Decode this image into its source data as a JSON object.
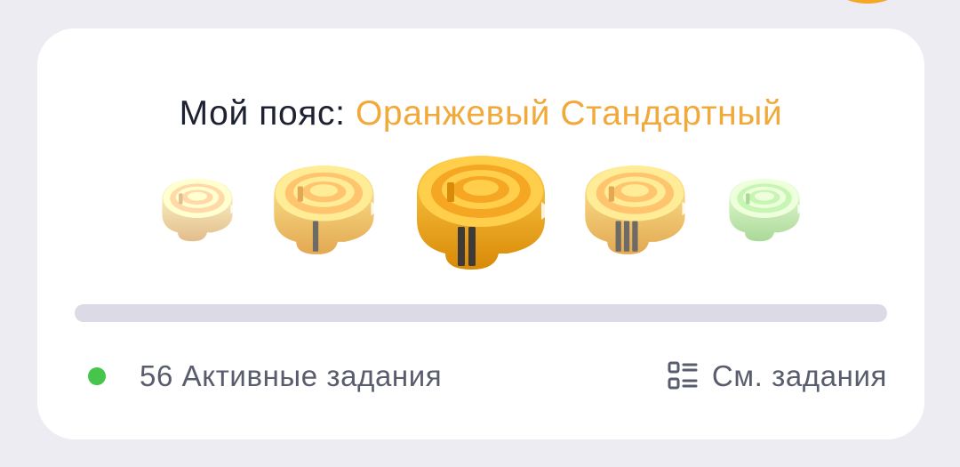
{
  "header": {
    "title_prefix": "Мой пояс:",
    "title_level": "Оранжевый Стандартный"
  },
  "belts": [
    {
      "name": "belt-level-1",
      "color": "#FFD9A8",
      "stripes": 0,
      "current": false
    },
    {
      "name": "belt-level-2",
      "color": "#FFC46E",
      "stripes": 1,
      "current": false
    },
    {
      "name": "belt-level-3",
      "color": "#F5A623",
      "stripes": 2,
      "current": true
    },
    {
      "name": "belt-level-4",
      "color": "#FFC46E",
      "stripes": 3,
      "current": false
    },
    {
      "name": "belt-level-5",
      "color": "#C6F5B4",
      "stripes": 0,
      "current": false
    }
  ],
  "progress": {
    "value": 0
  },
  "footer": {
    "active_tasks_label": "56 Активные задания",
    "view_tasks_label": "См. задания",
    "view_tasks_icon": "list-icon",
    "status_icon": "green-dot-icon"
  },
  "colors": {
    "accent": "#F2A93B",
    "status_active": "#45C54A",
    "card": "#FFFFFF",
    "background": "#EDECF3"
  }
}
